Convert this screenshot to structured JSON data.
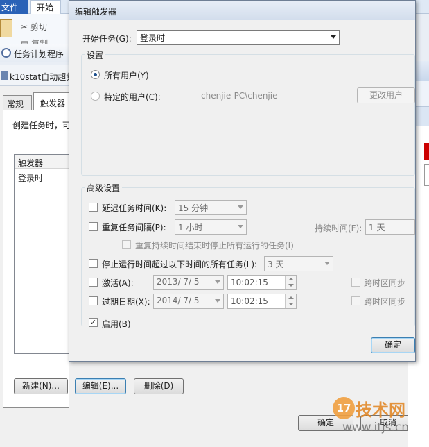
{
  "ribbon": {
    "file_tab": "文件",
    "start_tab": "开始",
    "cut": "剪切",
    "copy": "复制"
  },
  "task_scheduler_title": "任务计划程序",
  "task_window_title": "k10stat自动超频",
  "task_dialog": {
    "tabs": [
      "常规",
      "触发器"
    ],
    "create_text": "创建任务时，可",
    "list_header": "触发器",
    "list_rows": [
      "登录时"
    ],
    "new_button": "新建(N)...",
    "edit_button": "编辑(E)...",
    "delete_button": "删除(D)",
    "ok_button": "确定",
    "cancel_button": "取消"
  },
  "edit_trigger": {
    "title": "编辑触发器",
    "begin_task_label": "开始任务(G):",
    "begin_task_value": "登录时",
    "settings_label": "设置",
    "all_users": "所有用户(Y)",
    "specific_user": "特定的用户(C):",
    "user_value": "chenjie-PC\\chenjie",
    "change_user_button": "更改用户",
    "advanced_label": "高级设置",
    "delay_task": "延迟任务时间(K):",
    "delay_value": "15 分钟",
    "repeat_task": "重复任务间隔(P):",
    "repeat_value": "1 小时",
    "duration_label": "持续时间(F):",
    "duration_value": "1 天",
    "stop_repeat": "重复持续时间结束时停止所有运行的任务(I)",
    "stop_longer": "停止运行时间超过以下时间的所有任务(L):",
    "stop_value": "3 天",
    "activate": "激活(A):",
    "activate_date": "2013/  7/  5",
    "activate_time": "10:02:15",
    "sync_tz": "跨时区同步",
    "expire": "过期日期(X):",
    "expire_date": "2014/  7/  5",
    "expire_time": "10:02:15",
    "enabled": "启用(B)",
    "ok_button": "确定"
  },
  "watermark": {
    "badge": "17",
    "text": "技术网",
    "url": "www.itjs.cn"
  }
}
